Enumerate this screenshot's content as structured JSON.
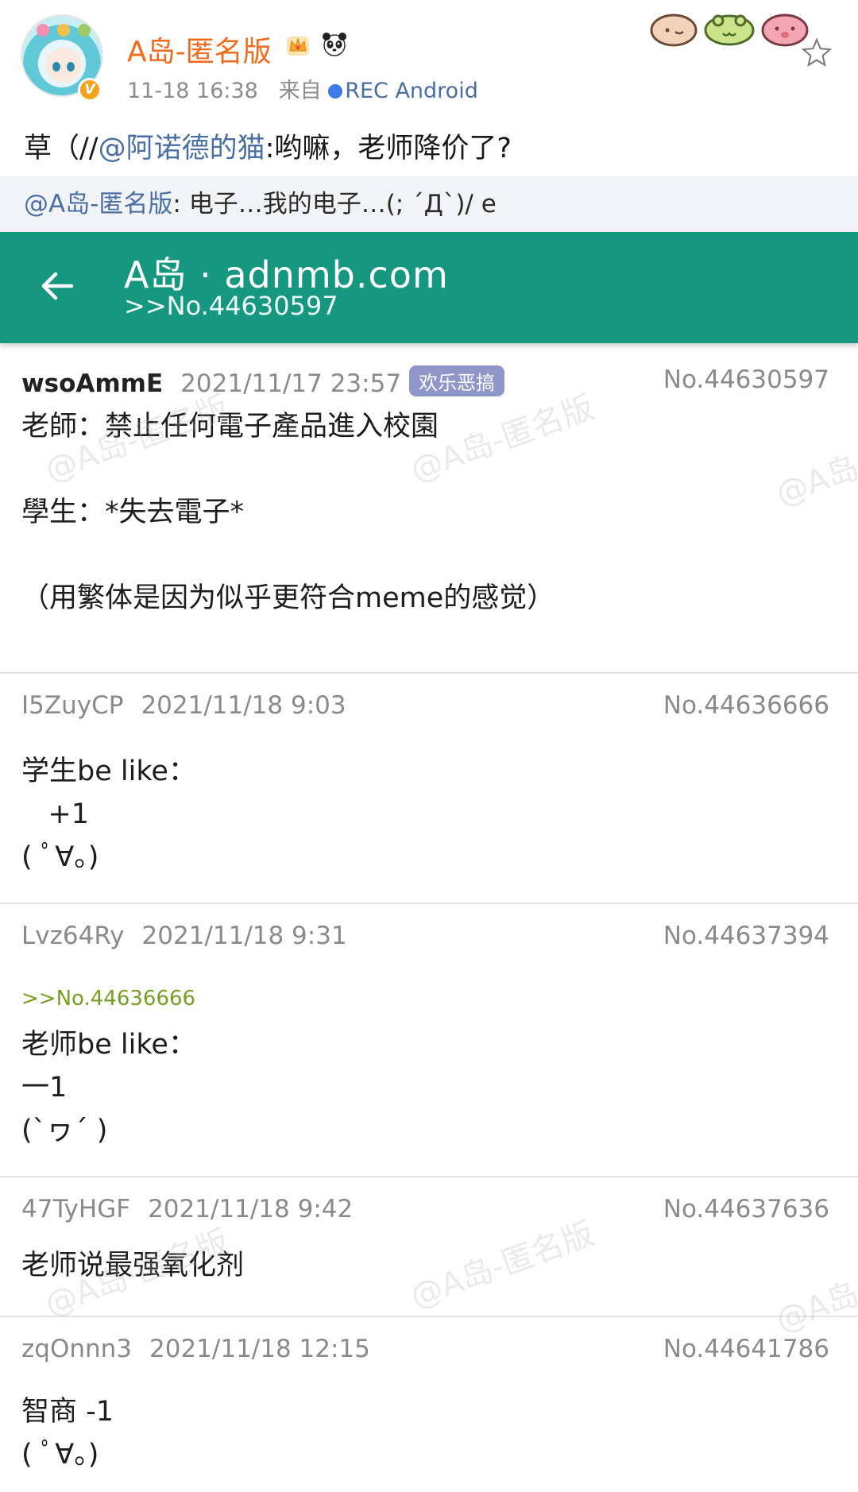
{
  "weibo": {
    "author": "A岛-匿名版",
    "badge": "V",
    "time": "11-18 16:38",
    "from_label": "来自",
    "source": "REC  Android",
    "text_prefix": "草（//",
    "text_mention": "@阿诺德的猫",
    "text_suffix": ":哟嘛，老师降价了?",
    "quote_mention": "@A岛-匿名版",
    "quote_text": ": 电子…我的电子…(; ´Д`)/     e"
  },
  "appbar": {
    "title": "A岛 · adnmb.com",
    "subtitle": ">>No.44630597"
  },
  "posts": [
    {
      "uid": "wsoAmmE",
      "time": "2021/11/17 23:57",
      "tag": "欢乐恶搞",
      "no": "No.44630597",
      "body": "老師：禁止任何電子產品進入校園\n\n學生：*失去電子*\n\n（用繁体是因为似乎更符合meme的感觉）"
    },
    {
      "uid": "I5ZuyCP",
      "time": "2021/11/18 9:03",
      "no": "No.44636666",
      "body": "学生be like：\n   +1\n( ﾟ∀。)"
    },
    {
      "uid": "Lvz64Ry",
      "time": "2021/11/18 9:31",
      "no": "No.44637394",
      "ref": ">>No.44636666",
      "body": "老师be like：\n一1\n(`ヮ´ )"
    },
    {
      "uid": "47TyHGF",
      "time": "2021/11/18 9:42",
      "no": "No.44637636",
      "body": "老师说最强氧化剂"
    },
    {
      "uid": "zqOnnn3",
      "time": "2021/11/18 12:15",
      "no": "No.44641786",
      "body": "智商 -1\n( ﾟ∀。)"
    }
  ],
  "watermark_text": "@A岛-匿名版",
  "colors": {
    "appbar": "#16977f",
    "author": "#f06b1c",
    "mention": "#4a6fa5",
    "tag": "#8f96c9",
    "quote_ref": "#78a020"
  }
}
